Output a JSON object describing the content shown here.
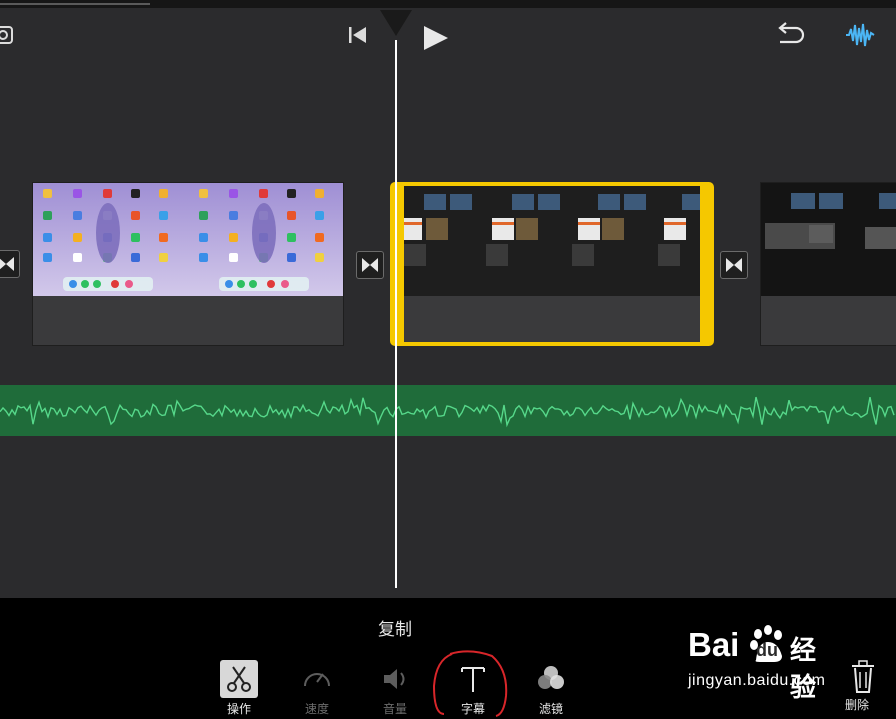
{
  "toolbar": {
    "rewind_icon": "skip-to-start-icon",
    "play_icon": "play-icon",
    "undo_icon": "undo-icon",
    "audio_icon": "audio-waveform-icon",
    "camera_icon": "camera-icon"
  },
  "timeline": {
    "clips": [
      {
        "id": "clip-1",
        "selected": false
      },
      {
        "id": "clip-2",
        "selected": true
      },
      {
        "id": "clip-3",
        "selected": false
      }
    ],
    "selection_color": "#f5c800",
    "audio_color": "#1f6c3a"
  },
  "bottom": {
    "action_title": "复制",
    "tools": [
      {
        "label": "操作",
        "icon": "scissors-icon",
        "state": "active"
      },
      {
        "label": "速度",
        "icon": "speedometer-icon",
        "state": "disabled"
      },
      {
        "label": "音量",
        "icon": "speaker-icon",
        "state": "disabled"
      },
      {
        "label": "字幕",
        "icon": "text-icon",
        "state": "enabled"
      },
      {
        "label": "滤镜",
        "icon": "filter-icon",
        "state": "enabled"
      }
    ],
    "delete_label": "删除"
  },
  "watermark": {
    "brand": "Bai",
    "brand2": "du",
    "cn": "经验",
    "url": "jingyan.baidu.com"
  }
}
